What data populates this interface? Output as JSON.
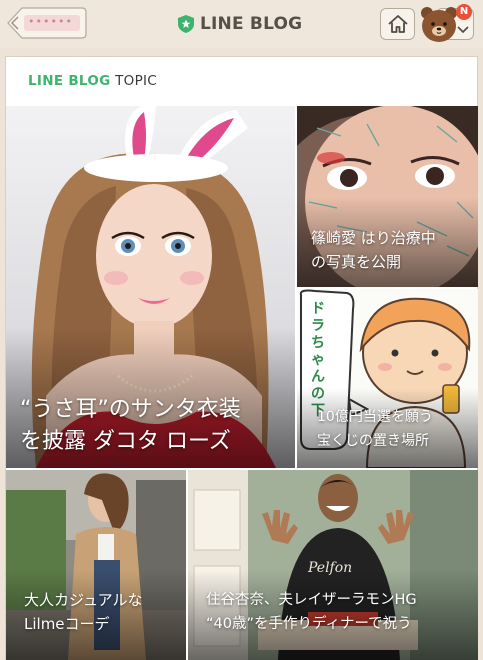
{
  "header": {
    "back_label": "••••••",
    "brand_title": "LINE BLOG",
    "notification_count": "N"
  },
  "section": {
    "title_brand": "LINE BLOG",
    "title_suffix": " TOPIC"
  },
  "tiles": {
    "main": {
      "line1": "“うさ耳”のサンタ衣装",
      "line2": "を披露 ダコタ ローズ"
    },
    "top_right": {
      "line1": "篠崎愛 はり治療中",
      "line2": "の写真を公開"
    },
    "mid_right": {
      "speech": "ドラちゃんの下",
      "line1": "10億円当選を願う",
      "line2": "宝くじの置き場所"
    },
    "bottom_left": {
      "line1": "大人カジュアルな",
      "line2": "Lilmeコーデ"
    },
    "bottom_right": {
      "shirt_text": "Pelfon",
      "line1": "住谷杏奈、夫レイザーラモンHG",
      "line2": "“40歳”を手作りディナーで祝う"
    }
  },
  "colors": {
    "brand_green": "#3db36b",
    "badge_red": "#e8503a",
    "header_bg": "#efe7dc"
  },
  "icons": {
    "back": "chevron-left-icon",
    "home": "home-icon",
    "avatar": "bear-avatar-icon",
    "dropdown": "chevron-down-icon",
    "brand": "line-shield-icon"
  }
}
